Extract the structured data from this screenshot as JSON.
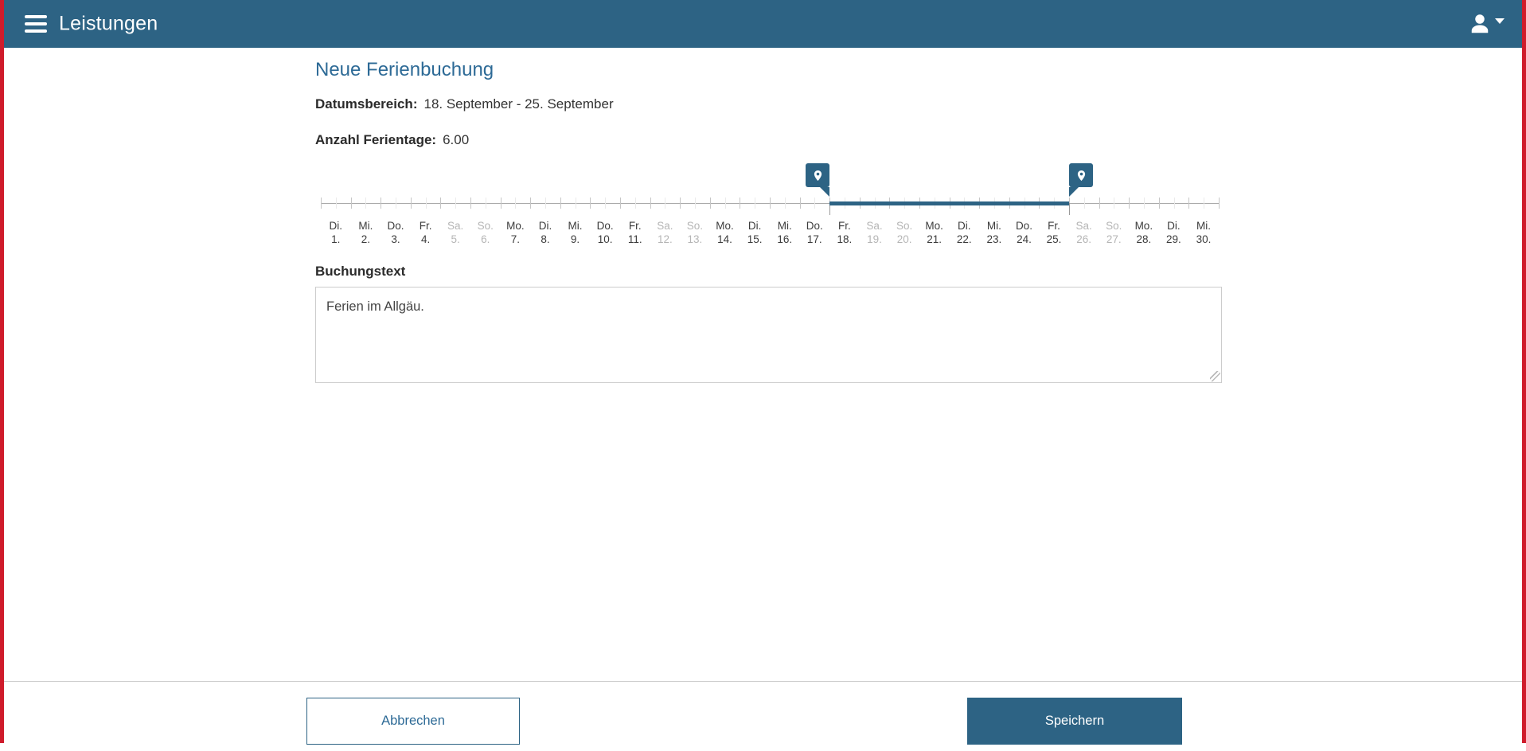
{
  "header": {
    "title": "Leistungen"
  },
  "colors": {
    "accent": "#2d6384",
    "edge_red": "#cf1b2b",
    "heading_blue": "#2d6a96",
    "weekend_gray": "#b5b5b5"
  },
  "form": {
    "title": "Neue Ferienbuchung",
    "date_range": {
      "label": "Datumsbereich:",
      "value": "18. September - 25. September"
    },
    "vacation_days": {
      "label": "Anzahl Ferientage:",
      "value": "6.00"
    },
    "booking_text": {
      "label": "Buchungstext",
      "value": "Ferien im Allgäu."
    }
  },
  "slider": {
    "selection_start_day": 18,
    "selection_end_day": 25,
    "days": [
      {
        "wd": "Di.",
        "d": "1.",
        "we": false
      },
      {
        "wd": "Mi.",
        "d": "2.",
        "we": false
      },
      {
        "wd": "Do.",
        "d": "3.",
        "we": false
      },
      {
        "wd": "Fr.",
        "d": "4.",
        "we": false
      },
      {
        "wd": "Sa.",
        "d": "5.",
        "we": true
      },
      {
        "wd": "So.",
        "d": "6.",
        "we": true
      },
      {
        "wd": "Mo.",
        "d": "7.",
        "we": false
      },
      {
        "wd": "Di.",
        "d": "8.",
        "we": false
      },
      {
        "wd": "Mi.",
        "d": "9.",
        "we": false
      },
      {
        "wd": "Do.",
        "d": "10.",
        "we": false
      },
      {
        "wd": "Fr.",
        "d": "11.",
        "we": false
      },
      {
        "wd": "Sa.",
        "d": "12.",
        "we": true
      },
      {
        "wd": "So.",
        "d": "13.",
        "we": true
      },
      {
        "wd": "Mo.",
        "d": "14.",
        "we": false
      },
      {
        "wd": "Di.",
        "d": "15.",
        "we": false
      },
      {
        "wd": "Mi.",
        "d": "16.",
        "we": false
      },
      {
        "wd": "Do.",
        "d": "17.",
        "we": false
      },
      {
        "wd": "Fr.",
        "d": "18.",
        "we": false
      },
      {
        "wd": "Sa.",
        "d": "19.",
        "we": true
      },
      {
        "wd": "So.",
        "d": "20.",
        "we": true
      },
      {
        "wd": "Mo.",
        "d": "21.",
        "we": false
      },
      {
        "wd": "Di.",
        "d": "22.",
        "we": false
      },
      {
        "wd": "Mi.",
        "d": "23.",
        "we": false
      },
      {
        "wd": "Do.",
        "d": "24.",
        "we": false
      },
      {
        "wd": "Fr.",
        "d": "25.",
        "we": false
      },
      {
        "wd": "Sa.",
        "d": "26.",
        "we": true
      },
      {
        "wd": "So.",
        "d": "27.",
        "we": true
      },
      {
        "wd": "Mo.",
        "d": "28.",
        "we": false
      },
      {
        "wd": "Di.",
        "d": "29.",
        "we": false
      },
      {
        "wd": "Mi.",
        "d": "30.",
        "we": false
      }
    ]
  },
  "footer": {
    "cancel_label": "Abbrechen",
    "save_label": "Speichern"
  }
}
